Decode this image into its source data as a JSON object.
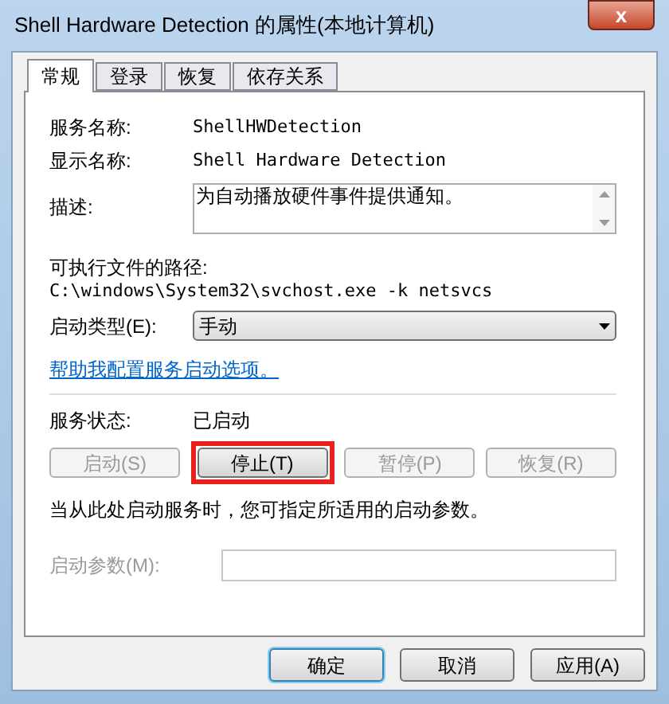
{
  "window": {
    "title": "Shell Hardware Detection 的属性(本地计算机)",
    "close": "x"
  },
  "tabs": [
    {
      "label": "常规",
      "selected": true
    },
    {
      "label": "登录",
      "selected": false
    },
    {
      "label": "恢复",
      "selected": false
    },
    {
      "label": "依存关系",
      "selected": false
    }
  ],
  "service_name": {
    "label": "服务名称:",
    "value": "ShellHWDetection"
  },
  "display_name": {
    "label": "显示名称:",
    "value": "Shell Hardware Detection"
  },
  "description": {
    "label": "描述:",
    "value": "为自动播放硬件事件提供通知。"
  },
  "path": {
    "label": "可执行文件的路径:",
    "value": "C:\\windows\\System32\\svchost.exe -k netsvcs"
  },
  "startup_type": {
    "label": "启动类型(E):",
    "value": "手动"
  },
  "help_link": "帮助我配置服务启动选项。",
  "service_status": {
    "label": "服务状态:",
    "value": "已启动"
  },
  "service_buttons": [
    {
      "label": "启动(S)",
      "disabled": true,
      "highlighted": false
    },
    {
      "label": "停止(T)",
      "disabled": false,
      "highlighted": true
    },
    {
      "label": "暂停(P)",
      "disabled": true,
      "highlighted": false
    },
    {
      "label": "恢复(R)",
      "disabled": true,
      "highlighted": false
    }
  ],
  "note": "当从此处启动服务时，您可指定所适用的启动参数。",
  "start_parameters": {
    "label": "启动参数(M):",
    "disabled": true
  },
  "dialog_buttons": [
    {
      "label": "确定",
      "default": true
    },
    {
      "label": "取消",
      "default": false
    },
    {
      "label": "应用(A)",
      "default": false
    }
  ]
}
